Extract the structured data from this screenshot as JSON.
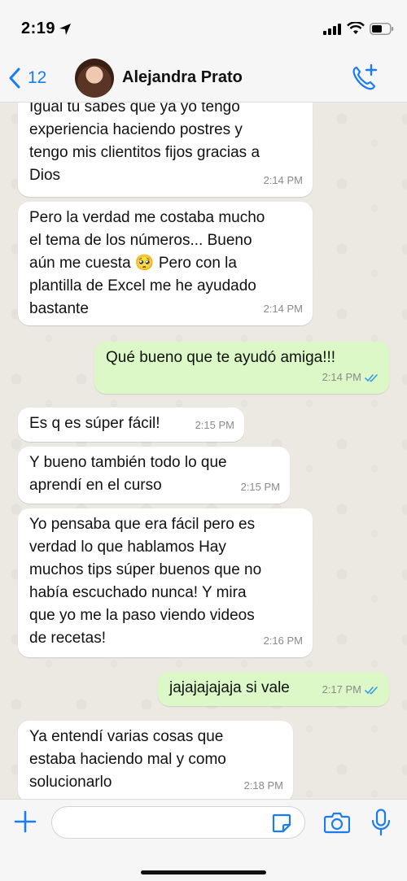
{
  "status_bar": {
    "time": "2:19"
  },
  "header": {
    "back_count": "12",
    "contact_name": "Alejandra Prato"
  },
  "messages": [
    {
      "direction": "in",
      "text": "Igual tu sabes que ya yo tengo\nexperiencia haciendo postres y\ntengo mis clientitos fijos gracias a\nDios",
      "time": "2:14 PM"
    },
    {
      "direction": "in",
      "text": "Pero la verdad me costaba mucho\nel tema de los números... Bueno\naún me cuesta 🥺 Pero con la\nplantilla de Excel me he ayudado\nbastante",
      "time": "2:14 PM"
    },
    {
      "direction": "out",
      "text": "Qué bueno que te ayudó amiga!!!",
      "time": "2:14 PM"
    },
    {
      "direction": "in",
      "text": "Es q es súper fácil!",
      "time": "2:15 PM"
    },
    {
      "direction": "in",
      "text": "Y bueno también todo lo que\naprendí en el curso",
      "time": "2:15 PM"
    },
    {
      "direction": "in",
      "text": "Yo pensaba que era fácil pero es\nverdad lo que hablamos Hay\nmuchos tips súper buenos que no\nhabía escuchado nunca! Y mira\nque yo me la paso viendo videos\nde recetas!",
      "time": "2:16 PM"
    },
    {
      "direction": "out",
      "text": "jajajajajaja si vale",
      "time": "2:17 PM"
    },
    {
      "direction": "in",
      "text": "Ya entendí varias cosas que\nestaba haciendo mal y como\nsolucionarlo",
      "time": "2:18 PM"
    }
  ],
  "input": {
    "value": "",
    "placeholder": ""
  },
  "colors": {
    "accent": "#1a7cf5",
    "outgoing_bubble": "#dcf8c6",
    "incoming_bubble": "#ffffff",
    "read_receipt": "#3b9be8"
  },
  "icons": [
    "location-arrow-icon",
    "signal-icon",
    "wifi-icon",
    "battery-icon",
    "chevron-left-icon",
    "add-call-icon",
    "plus-icon",
    "sticker-icon",
    "camera-icon",
    "microphone-icon",
    "double-check-icon"
  ]
}
